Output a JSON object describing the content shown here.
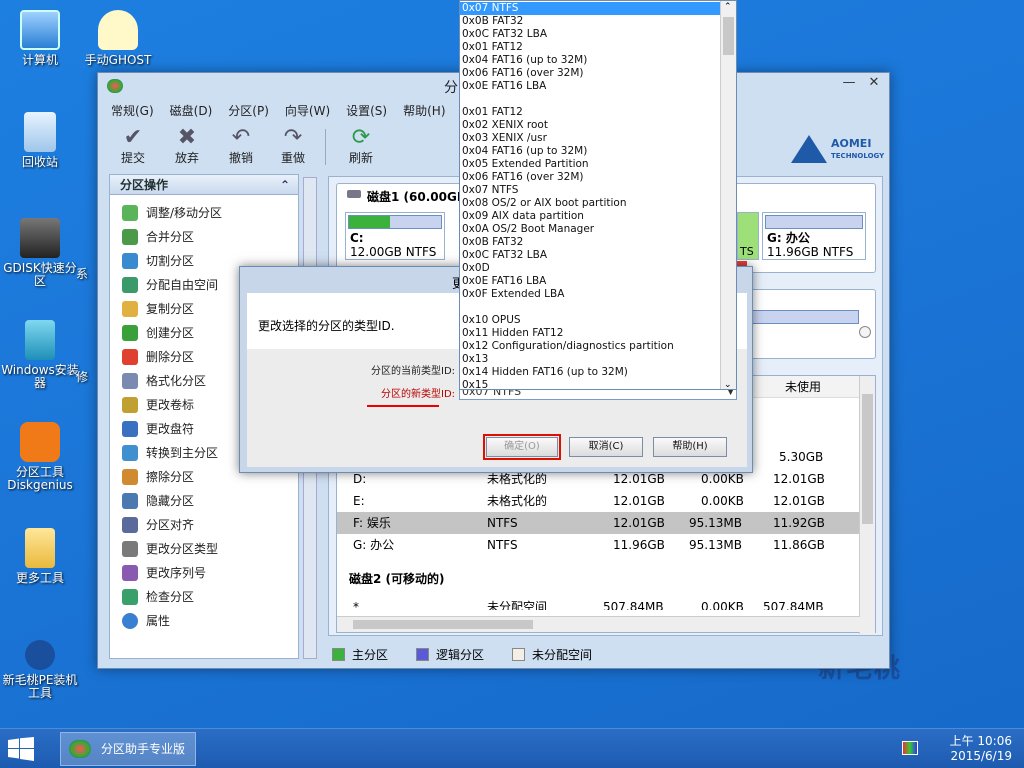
{
  "desktop": {
    "icons": [
      {
        "label": "计算机"
      },
      {
        "label": "手动GHOST"
      },
      {
        "label": "回收站"
      },
      {
        "label": "GDISK快速分区"
      },
      {
        "label": "系"
      },
      {
        "label": "Windows安装器"
      },
      {
        "label": "修"
      },
      {
        "label": "分区工具Diskgenius"
      },
      {
        "label": "更多工具"
      },
      {
        "label": "新毛桃PE装机工具"
      }
    ],
    "watermark": "新毛桃"
  },
  "window": {
    "title": "分",
    "controls": {
      "minimize": "—",
      "close": "✕"
    },
    "menu": [
      "常规(G)",
      "磁盘(D)",
      "分区(P)",
      "向导(W)",
      "设置(S)",
      "帮助(H)"
    ],
    "toolbar": [
      {
        "label": "提交",
        "icon": "check-icon"
      },
      {
        "label": "放弃",
        "icon": "x-icon"
      },
      {
        "label": "撤销",
        "icon": "undo-icon"
      },
      {
        "label": "重做",
        "icon": "redo-icon"
      },
      {
        "label": "刷新",
        "icon": "refresh-icon"
      }
    ],
    "brand": {
      "name": "AOMEI",
      "sub": "TECHNOLOGY"
    }
  },
  "left_panel": {
    "title": "分区操作",
    "collapse": "⌃",
    "operations": [
      "调整/移动分区",
      "合并分区",
      "切割分区",
      "分配自由空间",
      "复制分区",
      "创建分区",
      "删除分区",
      "格式化分区",
      "更改卷标",
      "更改盘符",
      "转换到主分区",
      "擦除分区",
      "隐藏分区",
      "分区对齐",
      "更改分区类型",
      "更改序列号",
      "检查分区",
      "属性"
    ]
  },
  "disk1": {
    "title": "磁盘1 (60.00GB",
    "partitions": [
      {
        "name": "C:",
        "size": "12.00GB NTFS",
        "fill": 0.45
      },
      {
        "name": "",
        "size": "TS",
        "fill": 1.0
      },
      {
        "name": "G: 办公",
        "size": "11.96GB NTFS",
        "fill": 0.0
      }
    ]
  },
  "table": {
    "header_unused": "未使用",
    "rows": [
      {
        "name": "",
        "fs": "",
        "cap": "",
        "used": "",
        "free": "5.30GB"
      },
      {
        "name": "D:",
        "fs": "未格式化的",
        "cap": "12.01GB",
        "used": "0.00KB",
        "free": "12.01GB"
      },
      {
        "name": "E:",
        "fs": "未格式化的",
        "cap": "12.01GB",
        "used": "0.00KB",
        "free": "12.01GB"
      },
      {
        "name": "F: 娱乐",
        "fs": "NTFS",
        "cap": "12.01GB",
        "used": "95.13MB",
        "free": "11.92GB"
      },
      {
        "name": "G: 办公",
        "fs": "NTFS",
        "cap": "11.96GB",
        "used": "95.13MB",
        "free": "11.86GB"
      }
    ],
    "disk2_title": "磁盘2 (可移动的)",
    "partial_row": {
      "name": "*",
      "fs": "未分配空间",
      "cap": "507.84MB",
      "used": "0.00KB",
      "free": "507.84MB"
    }
  },
  "legend": [
    "主分区",
    "逻辑分区",
    "未分配空间"
  ],
  "dialog": {
    "title": "更",
    "message": "更改选择的分区的类型ID.",
    "current_label": "分区的当前类型ID:",
    "new_label": "分区的新类型ID:",
    "combo_value": "0x07 NTFS",
    "ok": "确定(O)",
    "cancel": "取消(C)",
    "help": "帮助(H)"
  },
  "dropdown": {
    "selected": "0x07 NTFS",
    "options": [
      "0x07 NTFS",
      "0x0B FAT32",
      "0x0C FAT32 LBA",
      "0x01 FAT12",
      "0x04 FAT16 (up to 32M)",
      "0x06 FAT16 (over 32M)",
      "0x0E FAT16 LBA",
      "",
      "0x01 FAT12",
      "0x02 XENIX root",
      "0x03 XENIX /usr",
      "0x04 FAT16 (up to 32M)",
      "0x05 Extended Partition",
      "0x06 FAT16 (over 32M)",
      "0x07 NTFS",
      "0x08 OS/2 or AIX boot partition",
      "0x09 AIX data partition",
      "0x0A OS/2 Boot Manager",
      "0x0B FAT32",
      "0x0C FAT32 LBA",
      "0x0D",
      "0x0E FAT16 LBA",
      "0x0F Extended LBA",
      "",
      "0x10 OPUS",
      "0x11 Hidden FAT12",
      "0x12 Configuration/diagnostics partition",
      "0x13",
      "0x14 Hidden FAT16 (up to 32M)",
      "0x15"
    ]
  },
  "taskbar": {
    "app": "分区助手专业版",
    "time": "上午 10:06",
    "date": "2015/6/19"
  },
  "colors": {
    "primary": "#3bb23b",
    "logical": "#5a5ad6",
    "unallocated": "#f3efe6",
    "highlight": "#3399ff"
  }
}
